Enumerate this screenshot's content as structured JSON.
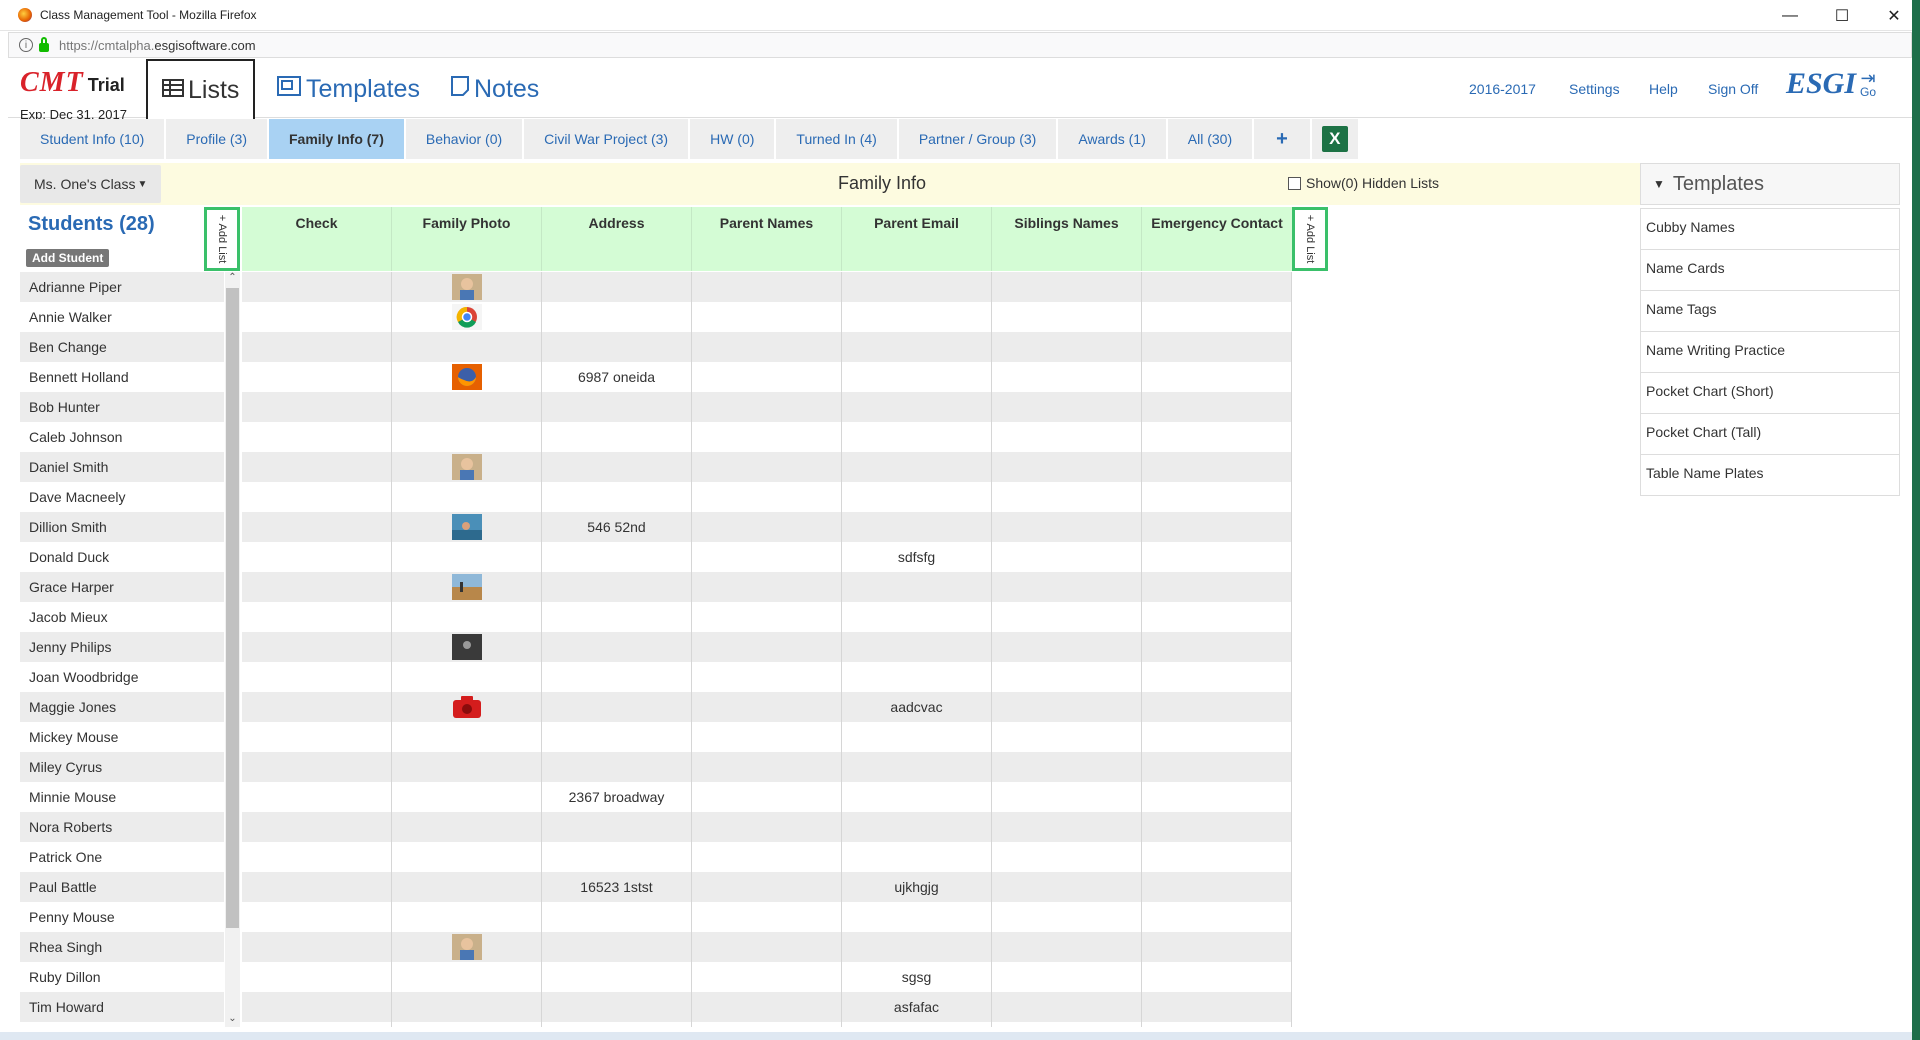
{
  "window": {
    "title": "Class Management Tool - Mozilla Firefox",
    "url_prefix": "https://cmtalpha.",
    "url_domain": "esgisoftware.com",
    "minimize": "—",
    "maximize": "☐",
    "close": "✕"
  },
  "brand": {
    "logo": "CMT",
    "trial": "Trial",
    "expiry": "Exp: Dec 31, 2017",
    "esgi": "ESGI",
    "go": "Go"
  },
  "main_tabs": [
    {
      "label": "Lists",
      "icon": "table-icon",
      "active": true
    },
    {
      "label": "Templates",
      "icon": "template-icon",
      "active": false
    },
    {
      "label": "Notes",
      "icon": "note-icon",
      "active": false
    }
  ],
  "top_nav": {
    "year": "2016-2017",
    "settings": "Settings",
    "help": "Help",
    "sign_off": "Sign Off"
  },
  "list_tabs": [
    {
      "label": "Student Info (10)",
      "active": false
    },
    {
      "label": "Profile (3)",
      "active": false
    },
    {
      "label": "Family Info (7)",
      "active": true
    },
    {
      "label": "Behavior (0)",
      "active": false
    },
    {
      "label": "Civil War Project (3)",
      "active": false
    },
    {
      "label": "HW (0)",
      "active": false
    },
    {
      "label": "Turned In (4)",
      "active": false
    },
    {
      "label": "Partner / Group (3)",
      "active": false
    },
    {
      "label": "Awards (1)",
      "active": false
    },
    {
      "label": "All (30)",
      "active": false
    }
  ],
  "add_tab": "+",
  "excel_label": "X",
  "class_selector": "Ms. One's Class",
  "list_title": "Family Info",
  "hidden_lists": "Show(0) Hidden Lists",
  "students": {
    "title": "Students (28)",
    "add_button": "Add Student",
    "add_list": "+ Add List"
  },
  "columns": [
    "Check",
    "Family Photo",
    "Address",
    "Parent Names",
    "Parent Email",
    "Siblings Names",
    "Emergency Contact"
  ],
  "rows": [
    {
      "name": "Adrianne Piper",
      "photo": "child-photo",
      "address": "",
      "email": ""
    },
    {
      "name": "Annie Walker",
      "photo": "chrome-logo",
      "address": "",
      "email": ""
    },
    {
      "name": "Ben Change",
      "photo": "",
      "address": "",
      "email": ""
    },
    {
      "name": "Bennett Holland",
      "photo": "firefox-logo",
      "address": "6987 oneida",
      "email": ""
    },
    {
      "name": "Bob Hunter",
      "photo": "",
      "address": "",
      "email": ""
    },
    {
      "name": "Caleb Johnson",
      "photo": "",
      "address": "",
      "email": ""
    },
    {
      "name": "Daniel Smith",
      "photo": "child-photo",
      "address": "",
      "email": ""
    },
    {
      "name": "Dave Macneely",
      "photo": "",
      "address": "",
      "email": ""
    },
    {
      "name": "Dillion Smith",
      "photo": "beach-photo",
      "address": "546 52nd",
      "email": ""
    },
    {
      "name": "Donald Duck",
      "photo": "",
      "address": "",
      "email": "sdfsfg"
    },
    {
      "name": "Grace Harper",
      "photo": "landscape-photo",
      "address": "",
      "email": ""
    },
    {
      "name": "Jacob Mieux",
      "photo": "",
      "address": "",
      "email": ""
    },
    {
      "name": "Jenny Philips",
      "photo": "dark-photo",
      "address": "",
      "email": ""
    },
    {
      "name": "Joan Woodbridge",
      "photo": "",
      "address": "",
      "email": ""
    },
    {
      "name": "Maggie Jones",
      "photo": "camera-icon",
      "address": "",
      "email": "aadcvac"
    },
    {
      "name": "Mickey Mouse",
      "photo": "",
      "address": "",
      "email": ""
    },
    {
      "name": "Miley Cyrus",
      "photo": "",
      "address": "",
      "email": ""
    },
    {
      "name": "Minnie Mouse",
      "photo": "",
      "address": "2367 broadway",
      "email": ""
    },
    {
      "name": "Nora Roberts",
      "photo": "",
      "address": "",
      "email": ""
    },
    {
      "name": "Patrick One",
      "photo": "",
      "address": "",
      "email": ""
    },
    {
      "name": "Paul Battle",
      "photo": "",
      "address": "16523 1stst",
      "email": "ujkhgjg"
    },
    {
      "name": "Penny Mouse",
      "photo": "",
      "address": "",
      "email": ""
    },
    {
      "name": "Rhea Singh",
      "photo": "child-photo",
      "address": "",
      "email": ""
    },
    {
      "name": "Ruby Dillon",
      "photo": "",
      "address": "",
      "email": "sgsg"
    },
    {
      "name": "Tim Howard",
      "photo": "",
      "address": "",
      "email": "asfafac"
    },
    {
      "name": "",
      "photo": "",
      "address": "",
      "email": ""
    }
  ],
  "templates": {
    "header": "Templates",
    "items": [
      "Cubby Names",
      "Name Cards",
      "Name Tags",
      "Name Writing Practice",
      "Pocket Chart (Short)",
      "Pocket Chart (Tall)",
      "Table Name Plates"
    ]
  },
  "colors": {
    "accent": "#2a6ab4",
    "active_tab": "#a9d2f3",
    "column_header": "#d4fcd5",
    "add_list_border": "#3ac06a",
    "toolbar": "#fdfbe0"
  }
}
